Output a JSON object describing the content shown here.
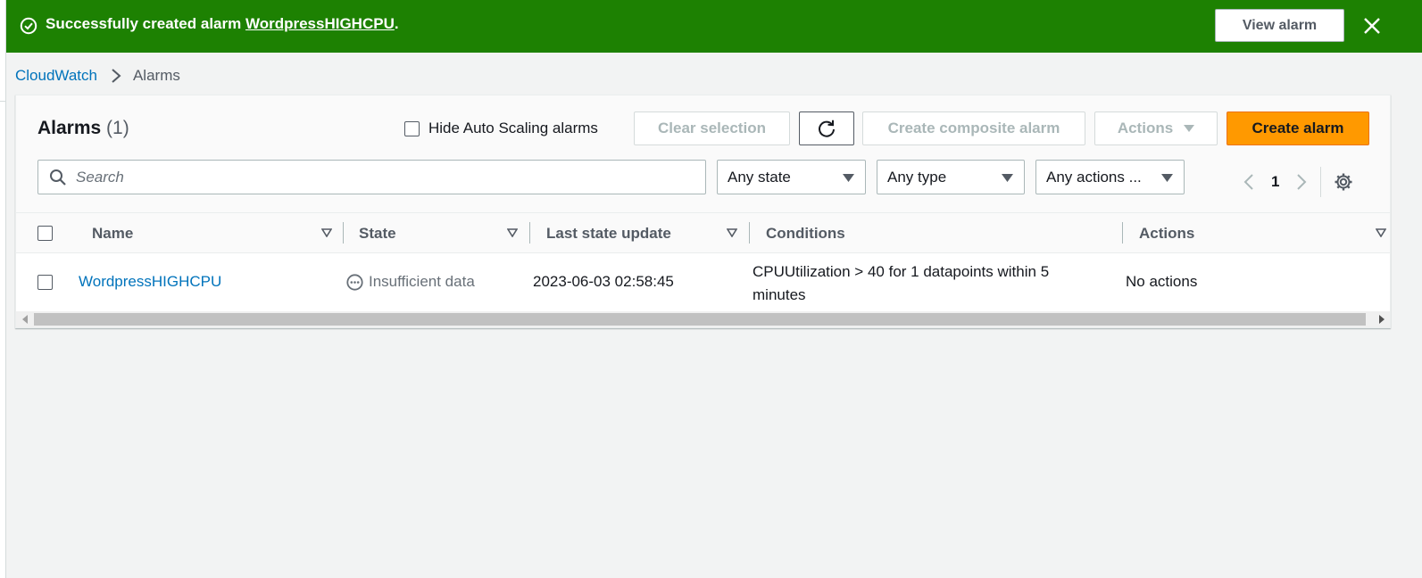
{
  "flash": {
    "message_prefix": "Successfully created alarm ",
    "alarm_link": "WordpressHIGHCPU",
    "message_suffix": ".",
    "view_button": "View alarm",
    "color": "#1d8102"
  },
  "breadcrumb": {
    "root": "CloudWatch",
    "current": "Alarms"
  },
  "panel": {
    "title": "Alarms",
    "count": "(1)",
    "hide_autoscaling_label": "Hide Auto Scaling alarms",
    "buttons": {
      "clear_selection": "Clear selection",
      "create_composite": "Create composite alarm",
      "actions": "Actions",
      "create_alarm": "Create alarm"
    },
    "search_placeholder": "Search",
    "filters": {
      "state": "Any state",
      "type": "Any type",
      "actions": "Any actions ..."
    },
    "page_number": "1"
  },
  "table": {
    "columns": [
      "Name",
      "State",
      "Last state update",
      "Conditions",
      "Actions"
    ],
    "rows": [
      {
        "name": "WordpressHIGHCPU",
        "state": "Insufficient data",
        "last_update": "2023-06-03 02:58:45",
        "conditions_line1": "CPUUtilization > 40 for 1 datapoints within 5",
        "conditions_line2": "minutes",
        "actions": "No actions"
      }
    ]
  },
  "colors": {
    "primary_button": "#ff9900",
    "link": "#0073bb"
  }
}
